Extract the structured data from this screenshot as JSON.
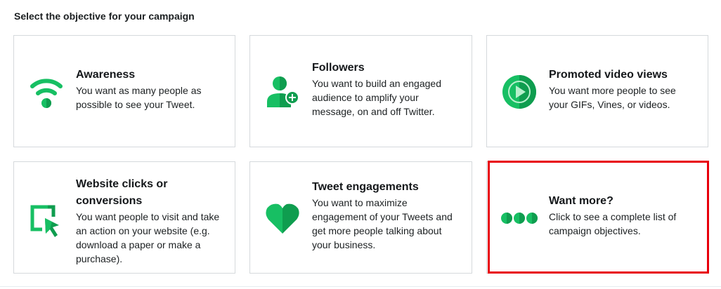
{
  "page": {
    "heading": "Select the objective for your campaign"
  },
  "colors": {
    "brand_green": "#17bf63",
    "brand_green_dark": "#0f9d4f",
    "highlight_red": "#e8000b"
  },
  "objectives": [
    {
      "title": "Awareness",
      "description": "You want as many people as possible to see your Tweet.",
      "icon": "wifi-broadcast-icon"
    },
    {
      "title": "Followers",
      "description": "You want to build an engaged audience to amplify your message, on and off Twitter.",
      "icon": "add-user-icon"
    },
    {
      "title": "Promoted video views",
      "description": "You want more people to see your GIFs, Vines, or videos.",
      "icon": "play-circle-icon"
    },
    {
      "title": "Website clicks or conversions",
      "description": "You want people to visit and take an action on your website (e.g. download a paper or make a purchase).",
      "icon": "cursor-click-icon"
    },
    {
      "title": "Tweet engagements",
      "description": "You want to maximize engagement of your Tweets and get more people talking about your business.",
      "icon": "heart-icon"
    },
    {
      "title": "Want more?",
      "description": "Click to see a complete list of campaign objectives.",
      "icon": "more-dots-icon"
    }
  ]
}
